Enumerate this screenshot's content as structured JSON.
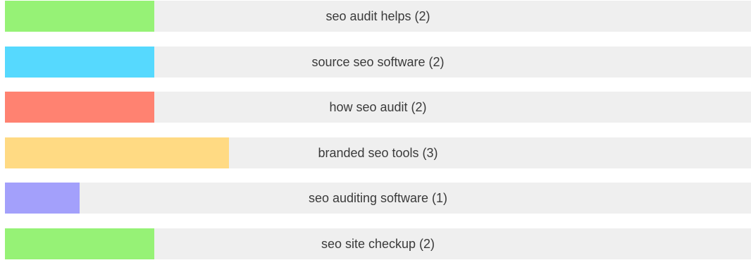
{
  "chart_data": {
    "type": "bar",
    "orientation": "horizontal",
    "max_value": 10,
    "items": [
      {
        "label": "seo audit helps (2)",
        "name": "seo audit helps",
        "value": 2,
        "color": "#96f276"
      },
      {
        "label": "source seo software (2)",
        "name": "source seo software",
        "value": 2,
        "color": "#56d9fe"
      },
      {
        "label": "how seo audit (2)",
        "name": "how seo audit",
        "value": 2,
        "color": "#ff8271"
      },
      {
        "label": "branded seo tools (3)",
        "name": "branded seo tools",
        "value": 3,
        "color": "#ffda83"
      },
      {
        "label": "seo auditing software (1)",
        "name": "seo auditing software",
        "value": 1,
        "color": "#a3a0fb"
      },
      {
        "label": "seo site checkup (2)",
        "name": "seo site checkup",
        "value": 2,
        "color": "#96f276"
      }
    ]
  }
}
